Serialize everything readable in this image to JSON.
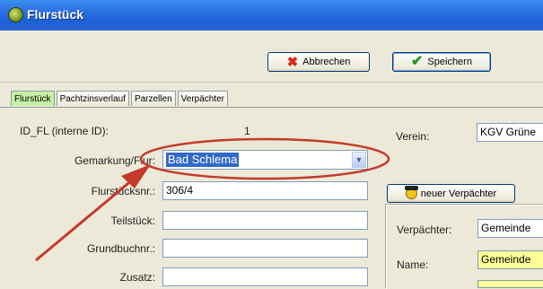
{
  "window": {
    "title": "Flurstück"
  },
  "toolbar": {
    "cancel_label": "Abbrechen",
    "save_label": "Speichern"
  },
  "tabs": [
    {
      "label": "Flurstück",
      "active": true
    },
    {
      "label": "Pachtzinsverlauf"
    },
    {
      "label": "Parzellen"
    },
    {
      "label": "Verpächter"
    }
  ],
  "form": {
    "id_label": "ID_FL (interne ID):",
    "id_value": "1",
    "gemarkung_label": "Gemarkung/Flur:",
    "gemarkung_value": "Bad Schlema",
    "flurstuecknr_label": "Flurstücksnr.:",
    "flurstuecknr_value": "306/4",
    "teilstueck_label": "Teilstück:",
    "teilstueck_value": "",
    "grundbuchnr_label": "Grundbuchnr.:",
    "grundbuchnr_value": "",
    "zusatz_label": "Zusatz:",
    "zusatz_value": ""
  },
  "right": {
    "verein_label": "Verein:",
    "verein_value": "KGV Grüne",
    "new_button_label": "neuer Verpächter",
    "verpaechter_label": "Verpächter:",
    "verpaechter_value": "Gemeinde",
    "name_label": "Name:",
    "name_value": "Gemeinde"
  },
  "icons": {
    "app": "app-icon",
    "cancel": "x-icon",
    "save": "check-icon",
    "new": "person-icon",
    "dropdown": "chevron-down-icon"
  },
  "colors": {
    "titlebar": "#2a6fe0",
    "active_tab": "#c6f0a6",
    "highlight_selection": "#316ac5",
    "annotation": "#c43a2b",
    "yellow_field": "#ffff99"
  }
}
